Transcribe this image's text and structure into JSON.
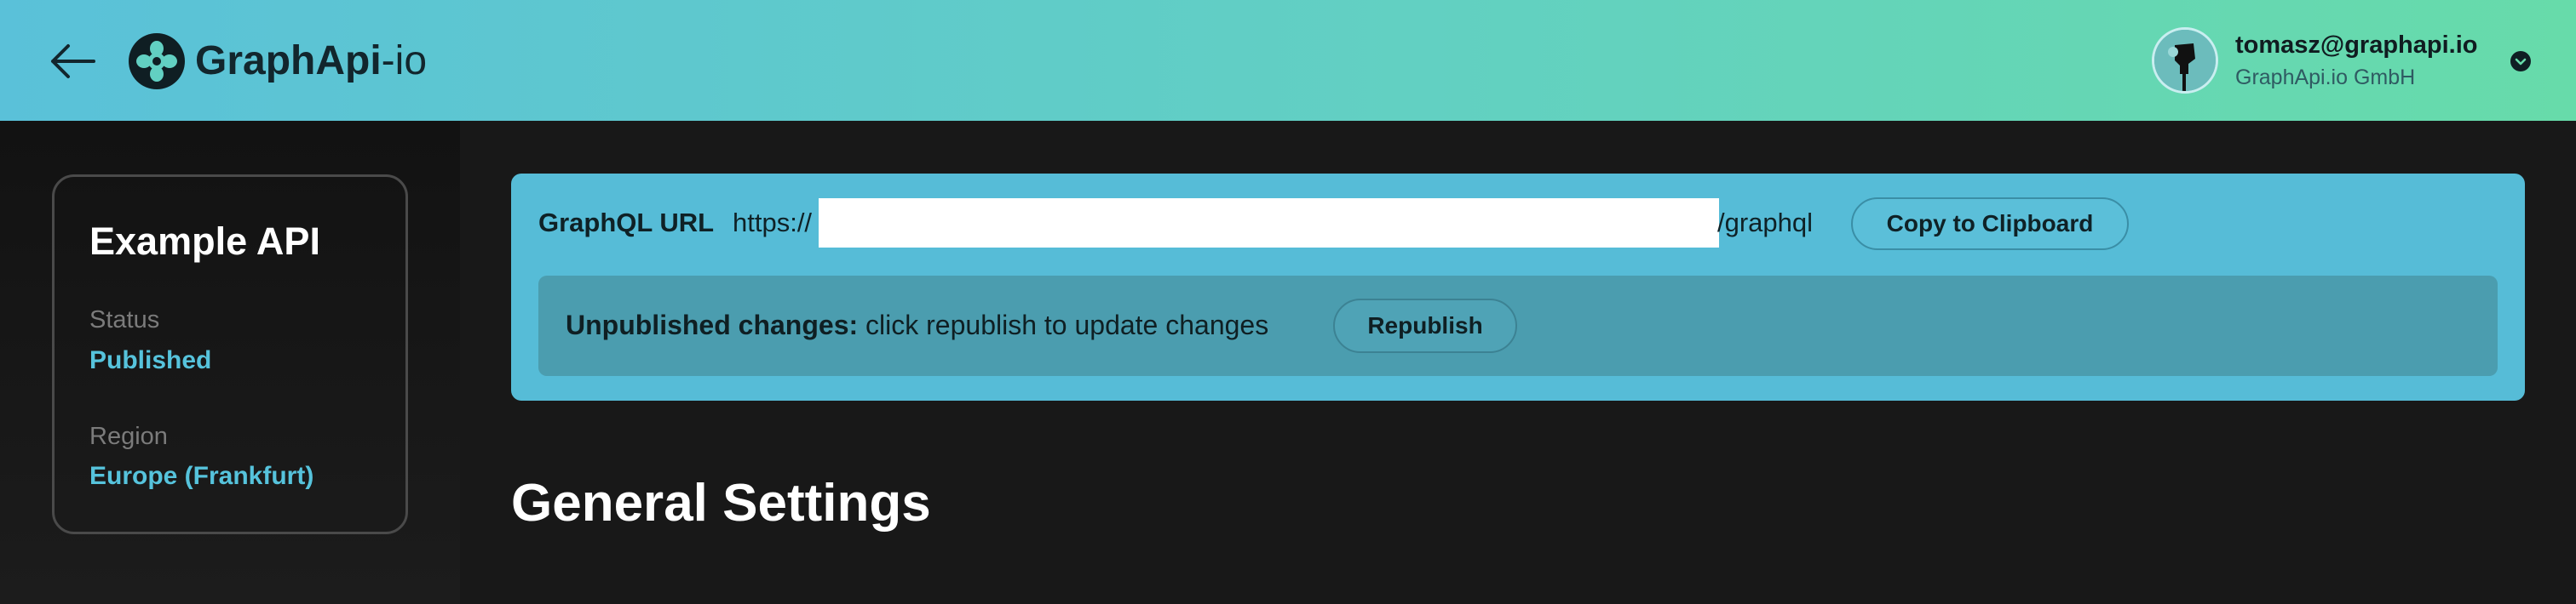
{
  "header": {
    "back_icon": "arrow-left-icon",
    "logo": {
      "icon": "graphapi-logo-icon",
      "name_bold": "GraphApi",
      "name_light": "-io"
    },
    "user": {
      "email": "tomasz@graphapi.io",
      "org": "GraphApi.io GmbH",
      "menu_icon": "chevron-down-icon"
    }
  },
  "sidebar": {
    "api_name": "Example API",
    "status_label": "Status",
    "status_value": "Published",
    "region_label": "Region",
    "region_value": "Europe (Frankfurt)"
  },
  "main": {
    "url": {
      "label": "GraphQL URL",
      "prefix": "https://",
      "suffix": "/graphql",
      "copy_label": "Copy to Clipboard"
    },
    "changes": {
      "strong": "Unpublished changes:",
      "text": " click republish to update changes",
      "republish_label": "Republish"
    },
    "section_title": "General Settings"
  },
  "colors": {
    "header_gradient_start": "#5ac1d9",
    "header_gradient_end": "#67dbaa",
    "accent": "#56c3dc",
    "background": "#181818",
    "url_panel": "#56bcd7",
    "changes_bar": "#4b9daf"
  }
}
